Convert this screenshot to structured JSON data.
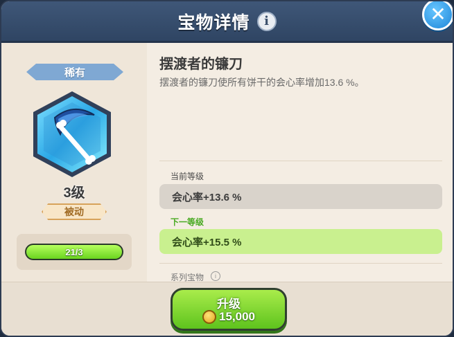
{
  "header": {
    "title": "宝物详情",
    "info_icon": "info-icon",
    "close_icon": "close-icon"
  },
  "treasure": {
    "rarity": "稀有",
    "level": "3级",
    "type": "被动",
    "progress_text": "21/3",
    "progress": 1.0,
    "name": "摆渡者的镰刀",
    "description": "摆渡者的镰刀使所有饼干的会心率增加13.6 %。"
  },
  "levels": {
    "current_label": "当前等级",
    "current_value": "会心率+13.6 %",
    "next_label": "下一等级",
    "next_value": "会心率+15.5 %",
    "series_label": "系列宝物"
  },
  "upgrade": {
    "label": "升级",
    "cost": "15,000",
    "cost_icon": "coin-icon"
  },
  "colors": {
    "accent_green": "#6ad41f",
    "header_blue": "#2f4563",
    "rarity_blue": "#7fa8d3"
  }
}
